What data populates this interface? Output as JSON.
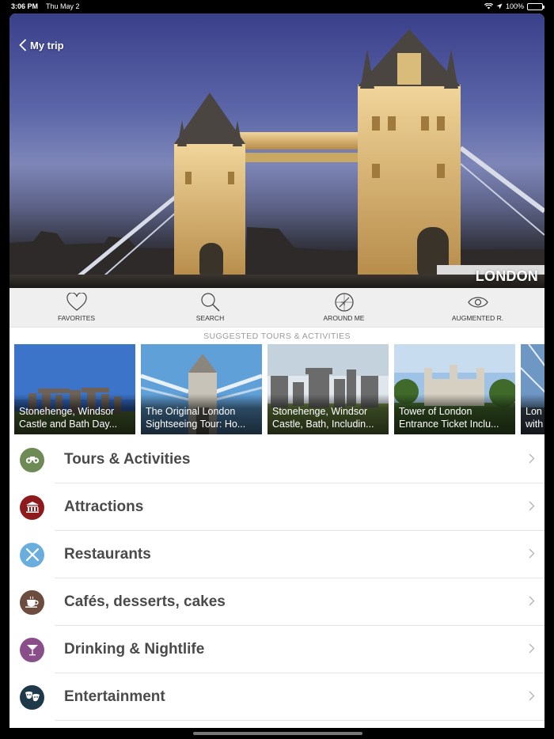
{
  "status_bar": {
    "time": "3:06 PM",
    "date": "Thu May 2",
    "battery": "100%"
  },
  "header": {
    "back_label": "My trip",
    "city": "LONDON"
  },
  "toolbar": [
    {
      "label": "FAVORITES",
      "icon": "heart-icon"
    },
    {
      "label": "SEARCH",
      "icon": "search-icon"
    },
    {
      "label": "AROUND ME",
      "icon": "compass-icon"
    },
    {
      "label": "AUGMENTED R.",
      "icon": "eye-icon"
    }
  ],
  "suggested": {
    "title": "SUGGESTED TOURS & ACTIVITIES",
    "cards": [
      {
        "line1": "Stonehenge, Windsor",
        "line2": "Castle and Bath Day..."
      },
      {
        "line1": "The Original London",
        "line2": "Sightseeing Tour: Ho..."
      },
      {
        "line1": "Stonehenge, Windsor",
        "line2": "Castle, Bath, Includin..."
      },
      {
        "line1": "Tower of London",
        "line2": "Entrance Ticket Inclu..."
      },
      {
        "line1": "Lon",
        "line2": "with"
      }
    ]
  },
  "categories": [
    {
      "label": "Tours & Activities",
      "icon": "binoculars-icon",
      "color": "#6e8a55"
    },
    {
      "label": "Attractions",
      "icon": "museum-icon",
      "color": "#8e1a1e"
    },
    {
      "label": "Restaurants",
      "icon": "cutlery-icon",
      "color": "#6aaede"
    },
    {
      "label": "Cafés, desserts, cakes",
      "icon": "coffee-cup-icon",
      "color": "#6b4c3f"
    },
    {
      "label": "Drinking & Nightlife",
      "icon": "cocktail-icon",
      "color": "#8a4f8a"
    },
    {
      "label": "Entertainment",
      "icon": "theater-masks-icon",
      "color": "#1e3a4a"
    }
  ]
}
